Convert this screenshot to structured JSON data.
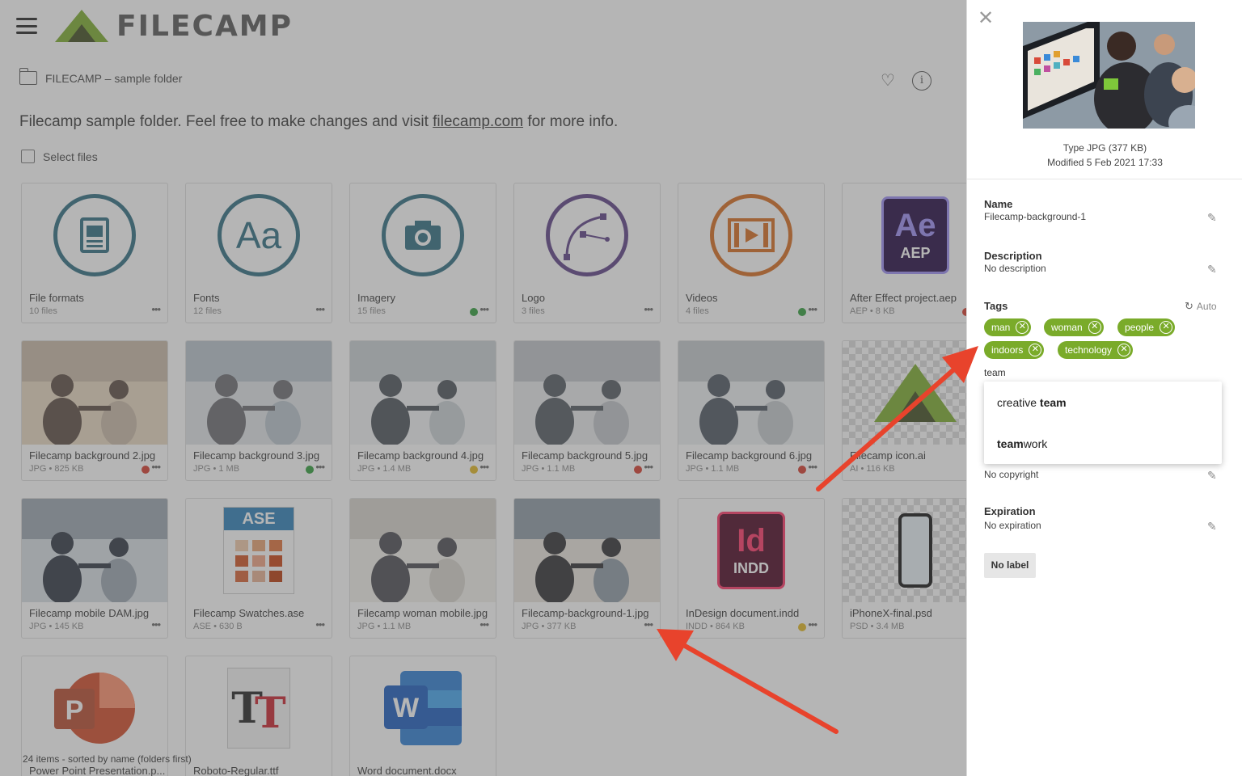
{
  "app": {
    "name": "FILECAMP"
  },
  "breadcrumb": {
    "folder": "FILECAMP – sample folder"
  },
  "description": {
    "before": "Filecamp sample folder. Feel free to make changes and visit ",
    "link": "filecamp.com",
    "after": " for more info."
  },
  "select_label": "Select files",
  "items": [
    {
      "name": "File formats",
      "meta": "10 files",
      "icon": "document-icon",
      "status": null
    },
    {
      "name": "Fonts",
      "meta": "12 files",
      "icon": "font-icon",
      "status": null
    },
    {
      "name": "Imagery",
      "meta": "15 files",
      "icon": "camera-icon",
      "status": "#2e9d3a"
    },
    {
      "name": "Logo",
      "meta": "3 files",
      "icon": "vector-pen-icon",
      "status": null
    },
    {
      "name": "Videos",
      "meta": "4 files",
      "icon": "film-icon",
      "status": "#2e9d3a"
    },
    {
      "name": "After Effect project.aep",
      "meta": "AEP • 8 KB",
      "icon": "after-effects-icon",
      "status": "#d63a2a"
    },
    {
      "name": "Filecamp background 2.jpg",
      "meta": "JPG • 825 KB",
      "icon": "photo",
      "status": "#d63a2a"
    },
    {
      "name": "Filecamp background 3.jpg",
      "meta": "JPG • 1 MB",
      "icon": "photo",
      "status": "#2e9d3a"
    },
    {
      "name": "Filecamp background 4.jpg",
      "meta": "JPG • 1.4 MB",
      "icon": "photo",
      "status": "#e2b71f"
    },
    {
      "name": "Filecamp background 5.jpg",
      "meta": "JPG • 1.1 MB",
      "icon": "photo",
      "status": "#d63a2a"
    },
    {
      "name": "Filecamp background 6.jpg",
      "meta": "JPG • 1.1 MB",
      "icon": "photo",
      "status": "#d63a2a"
    },
    {
      "name": "Filecamp icon.ai",
      "meta": "AI • 116 KB",
      "icon": "filecamp-logo-icon",
      "status": null
    },
    {
      "name": "Filecamp mobile DAM.jpg",
      "meta": "JPG • 145 KB",
      "icon": "photo",
      "status": null
    },
    {
      "name": "Filecamp Swatches.ase",
      "meta": "ASE • 630 B",
      "icon": "swatches-icon",
      "status": null
    },
    {
      "name": "Filecamp woman mobile.jpg",
      "meta": "JPG • 1.1 MB",
      "icon": "photo",
      "status": null
    },
    {
      "name": "Filecamp-background-1.jpg",
      "meta": "JPG • 377 KB",
      "icon": "photo",
      "status": null
    },
    {
      "name": "InDesign document.indd",
      "meta": "INDD • 864 KB",
      "icon": "indesign-icon",
      "status": "#e2b71f"
    },
    {
      "name": "iPhoneX-final.psd",
      "meta": "PSD • 3.4 MB",
      "icon": "phone-icon",
      "status": null
    },
    {
      "name": "Power Point Presentation.p...",
      "meta": "",
      "icon": "powerpoint-icon",
      "status": null
    },
    {
      "name": "Roboto-Regular.ttf",
      "meta": "",
      "icon": "truetype-icon",
      "status": null
    },
    {
      "name": "Word document.docx",
      "meta": "",
      "icon": "word-icon",
      "status": null
    }
  ],
  "footer": {
    "count": "24 items - sorted by name (folders first)"
  },
  "panel": {
    "type": "Type JPG (377 KB)",
    "modified": "Modified 5 Feb 2021 17:33",
    "name_label": "Name",
    "name_value": "Filecamp-background-1",
    "description_label": "Description",
    "description_value": "No description",
    "tags_label": "Tags",
    "auto_label": "Auto",
    "tags": [
      "man",
      "woman",
      "people",
      "indoors",
      "technology"
    ],
    "tag_input": "team",
    "suggestions": [
      {
        "pre": "creative ",
        "match": "team",
        "post": ""
      },
      {
        "pre": "",
        "match": "team",
        "post": "work"
      }
    ],
    "copyright_value": "No copyright",
    "expiration_label": "Expiration",
    "expiration_value": "No expiration",
    "label_button": "No label"
  },
  "colors": {
    "brand_green": "#7aab2a",
    "annotation_arrow": "#e8432c"
  }
}
